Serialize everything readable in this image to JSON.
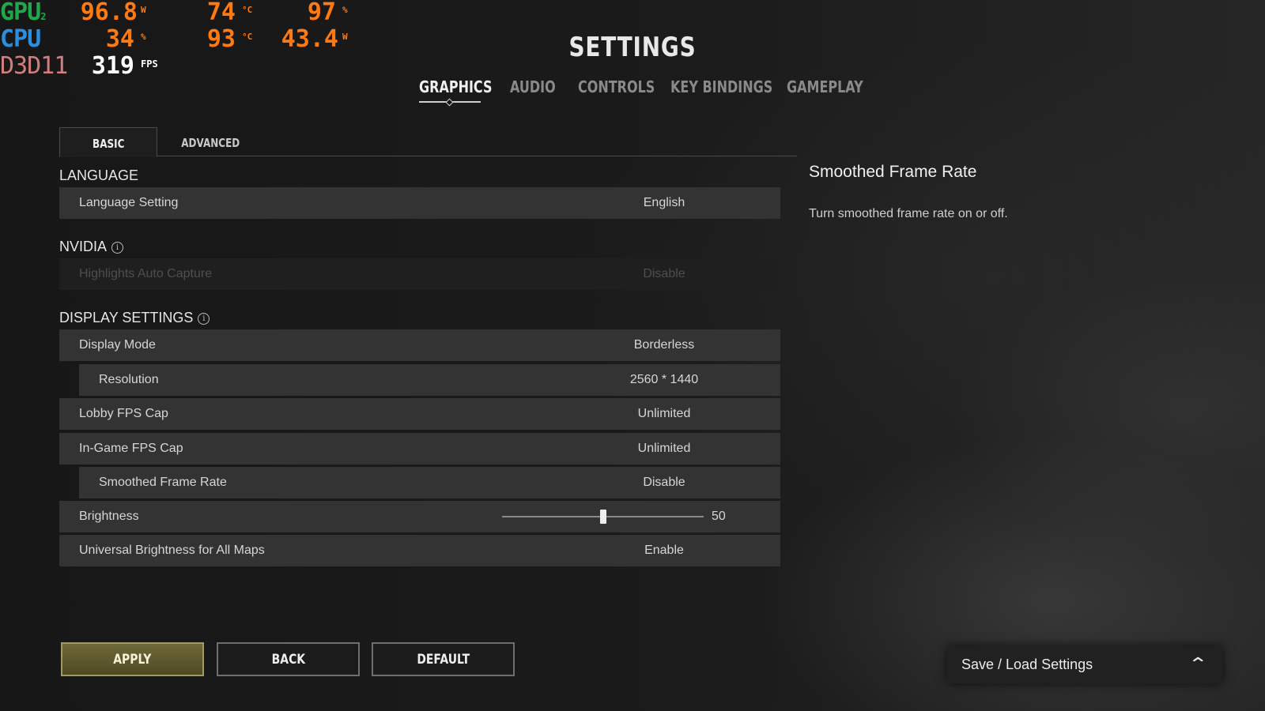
{
  "overlay": {
    "gpu": {
      "label": "GPU",
      "sub": "2",
      "power": "96.8",
      "power_unit": "W",
      "temp": "74",
      "temp_unit": "°C",
      "load": "97",
      "load_unit": "%"
    },
    "cpu": {
      "label": "CPU",
      "load": "34",
      "load_unit": "%",
      "temp": "93",
      "temp_unit": "°C",
      "power": "43.4",
      "power_unit": "W"
    },
    "api": {
      "label": "D3D11",
      "fps": "319",
      "fps_unit": "FPS"
    },
    "colors": {
      "gpu": "#1fa84a",
      "cpu": "#2b8fe0",
      "api": "#d27e7e",
      "values": "#ff7a10",
      "fps": "#ffffff"
    }
  },
  "header": {
    "title": "SETTINGS",
    "tabs": [
      "GRAPHICS",
      "AUDIO",
      "CONTROLS",
      "KEY BINDINGS",
      "GAMEPLAY"
    ],
    "active_tab": "GRAPHICS"
  },
  "subtabs": {
    "items": [
      "BASIC",
      "ADVANCED"
    ],
    "active": "BASIC"
  },
  "sections": {
    "language": {
      "title": "LANGUAGE",
      "rows": [
        {
          "label": "Language Setting",
          "value": "English"
        }
      ]
    },
    "nvidia": {
      "title": "NVIDIA",
      "rows": [
        {
          "label": "Highlights Auto Capture",
          "value": "Disable",
          "disabled": true
        }
      ]
    },
    "display": {
      "title": "DISPLAY SETTINGS",
      "rows": [
        {
          "label": "Display Mode",
          "value": "Borderless"
        },
        {
          "label": "Resolution",
          "value": "2560 * 1440"
        },
        {
          "label": "Lobby FPS Cap",
          "value": "Unlimited"
        },
        {
          "label": "In-Game FPS Cap",
          "value": "Unlimited"
        },
        {
          "label": "Smoothed Frame Rate",
          "value": "Disable"
        },
        {
          "label": "Brightness",
          "value": "50",
          "slider_fraction": 0.5
        },
        {
          "label": "Universal Brightness for All Maps",
          "value": "Enable"
        }
      ]
    }
  },
  "description": {
    "title": "Smoothed Frame Rate",
    "text": "Turn smoothed frame rate on or off."
  },
  "buttons": {
    "apply": "APPLY",
    "back": "BACK",
    "default": "DEFAULT"
  },
  "save_load": {
    "label": "Save / Load Settings",
    "icon": "chevron-up-icon"
  }
}
